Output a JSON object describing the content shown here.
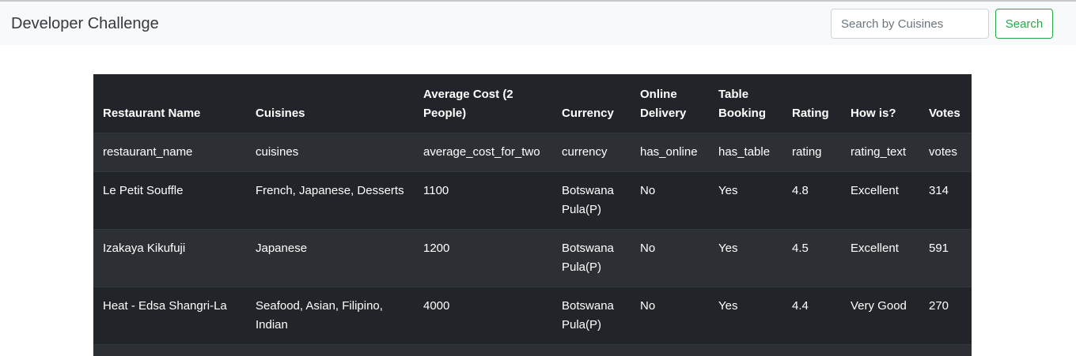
{
  "navbar": {
    "brand": "Developer Challenge",
    "search_placeholder": "Search by Cuisines",
    "search_value": "",
    "search_button": "Search"
  },
  "colors": {
    "success": "#28a745",
    "table_dark": "#212529",
    "table_stripe": "#2c3034",
    "navbar_bg": "#f8f9fa"
  },
  "table": {
    "headers": [
      "Restaurant Name",
      "Cuisines",
      "Average Cost (2 People)",
      "Currency",
      "Online Delivery",
      "Table Booking",
      "Rating",
      "How is?",
      "Votes"
    ],
    "rows": [
      [
        "restaurant_name",
        "cuisines",
        "average_cost_for_two",
        "currency",
        "has_online",
        "has_table",
        "rating",
        "rating_text",
        "votes"
      ],
      [
        "Le Petit Souffle",
        "French, Japanese, Desserts",
        "1100",
        "Botswana Pula(P)",
        "No",
        "Yes",
        "4.8",
        "Excellent",
        "314"
      ],
      [
        "Izakaya Kikufuji",
        "Japanese",
        "1200",
        "Botswana Pula(P)",
        "No",
        "Yes",
        "4.5",
        "Excellent",
        "591"
      ],
      [
        "Heat - Edsa Shangri-La",
        "Seafood, Asian, Filipino, Indian",
        "4000",
        "Botswana Pula(P)",
        "No",
        "Yes",
        "4.4",
        "Very Good",
        "270"
      ]
    ]
  }
}
